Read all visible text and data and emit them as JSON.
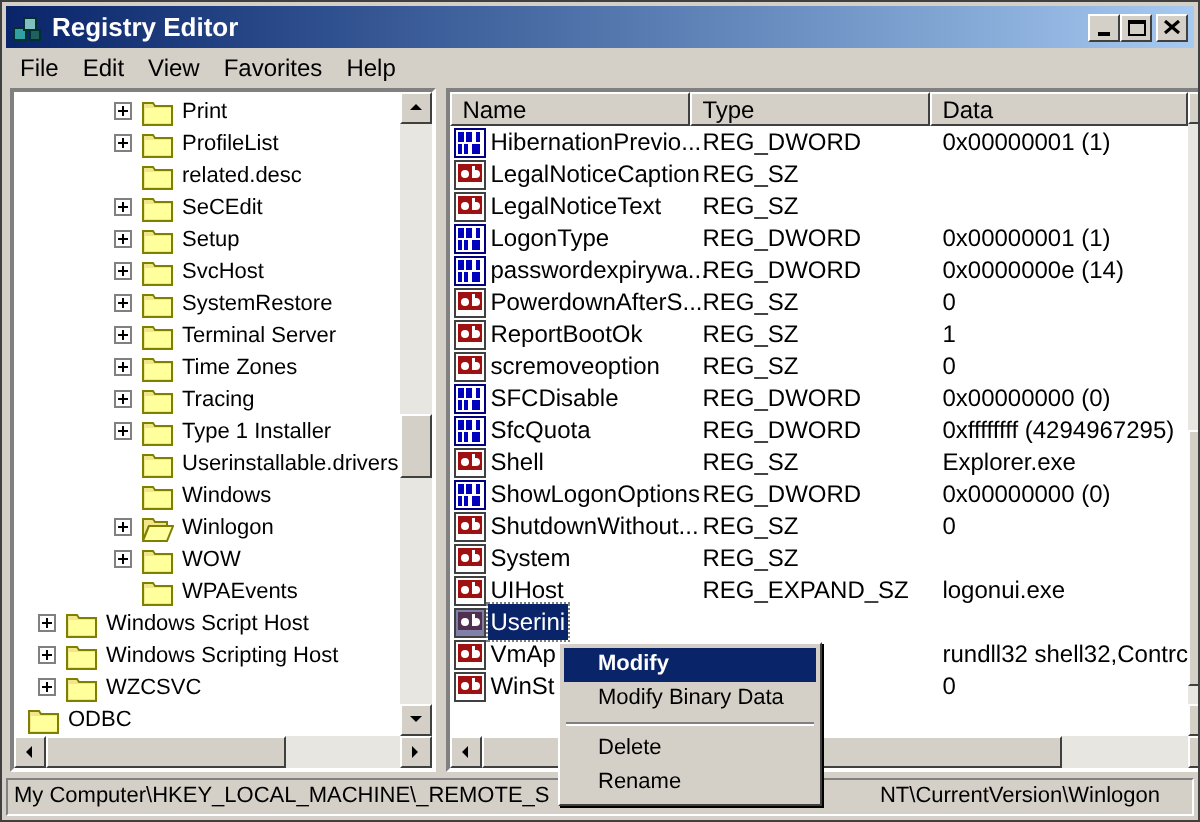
{
  "window": {
    "title": "Registry Editor"
  },
  "menu_bar": [
    "File",
    "Edit",
    "View",
    "Favorites",
    "Help"
  ],
  "tree": {
    "items": [
      {
        "children": [
          {
            "children": [
              {
                "children": [
                  {
                    "label": "Print",
                    "expandable": true,
                    "open": false
                  },
                  {
                    "label": "ProfileList",
                    "expandable": true,
                    "open": false
                  },
                  {
                    "label": "related.desc",
                    "expandable": false,
                    "open": false
                  },
                  {
                    "label": "SeCEdit",
                    "expandable": true,
                    "open": false
                  },
                  {
                    "label": "Setup",
                    "expandable": true,
                    "open": false
                  },
                  {
                    "label": "SvcHost",
                    "expandable": true,
                    "open": false
                  },
                  {
                    "label": "SystemRestore",
                    "expandable": true,
                    "open": false
                  },
                  {
                    "label": "Terminal Server",
                    "expandable": true,
                    "open": false
                  },
                  {
                    "label": "Time Zones",
                    "expandable": true,
                    "open": false
                  },
                  {
                    "label": "Tracing",
                    "expandable": true,
                    "open": false
                  },
                  {
                    "label": "Type 1 Installer",
                    "expandable": true,
                    "open": false
                  },
                  {
                    "label": "Userinstallable.drivers",
                    "expandable": false,
                    "open": false
                  },
                  {
                    "label": "Windows",
                    "expandable": false,
                    "open": false
                  },
                  {
                    "label": "Winlogon",
                    "expandable": true,
                    "open": true
                  },
                  {
                    "label": "WOW",
                    "expandable": true,
                    "open": false
                  },
                  {
                    "label": "WPAEvents",
                    "expandable": false,
                    "open": false
                  }
                ]
              }
            ]
          },
          {
            "label": "Windows Script Host",
            "expandable": true,
            "open": false
          },
          {
            "label": "Windows Scripting Host",
            "expandable": true,
            "open": false
          },
          {
            "label": "WZCSVC",
            "expandable": true,
            "open": false
          }
        ]
      },
      {
        "label": "ODBC",
        "expandable": false,
        "open": false
      }
    ]
  },
  "list": {
    "columns": [
      "Name",
      "Type",
      "Data"
    ],
    "rows": [
      {
        "kind": "binary",
        "name": "HibernationPrevio...",
        "type": "REG_DWORD",
        "data": "0x00000001 (1)",
        "selected": false
      },
      {
        "kind": "string",
        "name": "LegalNoticeCaption",
        "type": "REG_SZ",
        "selected": false
      },
      {
        "kind": "string",
        "name": "LegalNoticeText",
        "type": "REG_SZ",
        "selected": false
      },
      {
        "kind": "binary",
        "name": "LogonType",
        "type": "REG_DWORD",
        "data": "0x00000001 (1)",
        "selected": false
      },
      {
        "kind": "binary",
        "name": "passwordexpirywa...",
        "type": "REG_DWORD",
        "data": "0x0000000e (14)",
        "selected": false
      },
      {
        "kind": "string",
        "name": "PowerdownAfterS...",
        "type": "REG_SZ",
        "data": "0",
        "selected": false
      },
      {
        "kind": "string",
        "name": "ReportBootOk",
        "type": "REG_SZ",
        "data": "1",
        "selected": false
      },
      {
        "kind": "string",
        "name": "scremoveoption",
        "type": "REG_SZ",
        "data": "0",
        "selected": false
      },
      {
        "kind": "binary",
        "name": "SFCDisable",
        "type": "REG_DWORD",
        "data": "0x00000000 (0)",
        "selected": false
      },
      {
        "kind": "binary",
        "name": "SfcQuota",
        "type": "REG_DWORD",
        "data": "0xffffffff (4294967295)",
        "selected": false
      },
      {
        "kind": "string",
        "name": "Shell",
        "type": "REG_SZ",
        "data": "Explorer.exe",
        "selected": false
      },
      {
        "kind": "binary",
        "name": "ShowLogonOptions",
        "type": "REG_DWORD",
        "data": "0x00000000 (0)",
        "selected": false
      },
      {
        "kind": "string",
        "name": "ShutdownWithout...",
        "type": "REG_SZ",
        "data": "0",
        "selected": false
      },
      {
        "kind": "string",
        "name": "System",
        "type": "REG_SZ",
        "selected": false
      },
      {
        "kind": "string",
        "name": "UIHost",
        "type": "REG_EXPAND_SZ",
        "data": "logonui.exe",
        "selected": false
      },
      {
        "kind": "string",
        "name": "Userini",
        "selected": true
      },
      {
        "kind": "string",
        "name": "VmAp",
        "data": "rundll32 shell32,Contrc",
        "selected": false
      },
      {
        "kind": "string",
        "name": "WinSt",
        "data": "0",
        "selected": false
      }
    ]
  },
  "context_menu": [
    {
      "kind": "item",
      "label": "Modify",
      "default": true,
      "selected": true
    },
    {
      "kind": "item",
      "label": "Modify Binary Data",
      "default": false,
      "selected": false
    },
    {
      "kind": "separator"
    },
    {
      "kind": "item",
      "label": "Delete",
      "default": false,
      "selected": false
    },
    {
      "kind": "item",
      "label": "Rename",
      "default": false,
      "selected": false
    }
  ],
  "status_bar": [
    "My Computer\\HKEY_LOCAL_MACHINE\\_REMOTE_S",
    "NT\\CurrentVersion\\Winlogon"
  ]
}
